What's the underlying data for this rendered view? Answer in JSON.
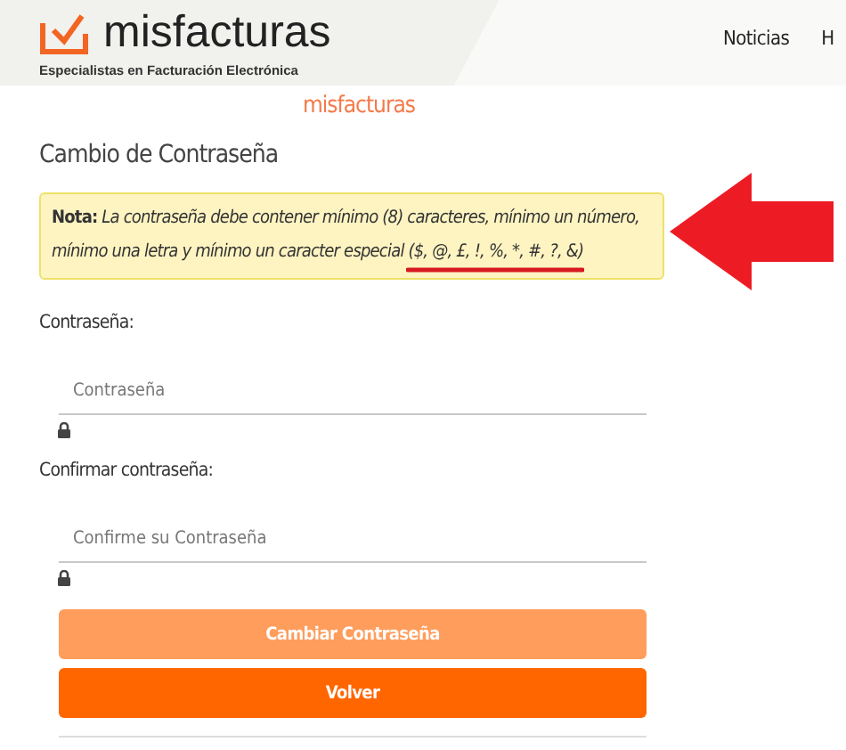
{
  "header": {
    "brand": "misfacturas",
    "tagline": "Especialistas en Facturación Electrónica",
    "nav": [
      "Noticias",
      "H"
    ]
  },
  "site_title": "misfacturas",
  "form": {
    "title": "Cambio de Contraseña",
    "note": {
      "label": "Nota:",
      "text": "La contraseña debe contener mínimo (8) caracteres, mínimo un número, mínimo una letra y mínimo un caracter especial ($, @, £, !, %, *, #, ?, &)"
    },
    "fields": [
      {
        "label": "Contraseña:",
        "placeholder": "Contraseña"
      },
      {
        "label": "Confirmar contraseña:",
        "placeholder": "Confirme su Contraseña"
      }
    ],
    "buttons": [
      {
        "label": "Cambiar Contraseña",
        "disabled": true
      },
      {
        "label": "Volver",
        "disabled": false
      }
    ]
  }
}
